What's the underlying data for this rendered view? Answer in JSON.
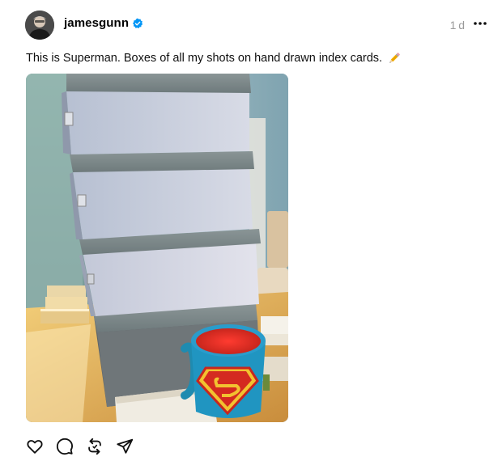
{
  "post": {
    "author": {
      "username": "jamesgunn",
      "verified": true,
      "avatar_icon": "profile-photo-avatar"
    },
    "timestamp": "1d",
    "menu_icon": "more-dots-icon",
    "caption": "This is Superman. Boxes of all my shots on hand drawn index cards.",
    "caption_emoji": "pencil-icon",
    "image": {
      "icon": "photo-stacked-boxes-with-superman-mug"
    },
    "actions": [
      {
        "name": "like",
        "icon": "heart-icon"
      },
      {
        "name": "reply",
        "icon": "comment-icon"
      },
      {
        "name": "repost",
        "icon": "repost-icon"
      },
      {
        "name": "share",
        "icon": "send-icon"
      }
    ]
  },
  "colors": {
    "verified_badge": "#0095f6",
    "timestamp": "#9a9a9a",
    "text": "#101010"
  }
}
